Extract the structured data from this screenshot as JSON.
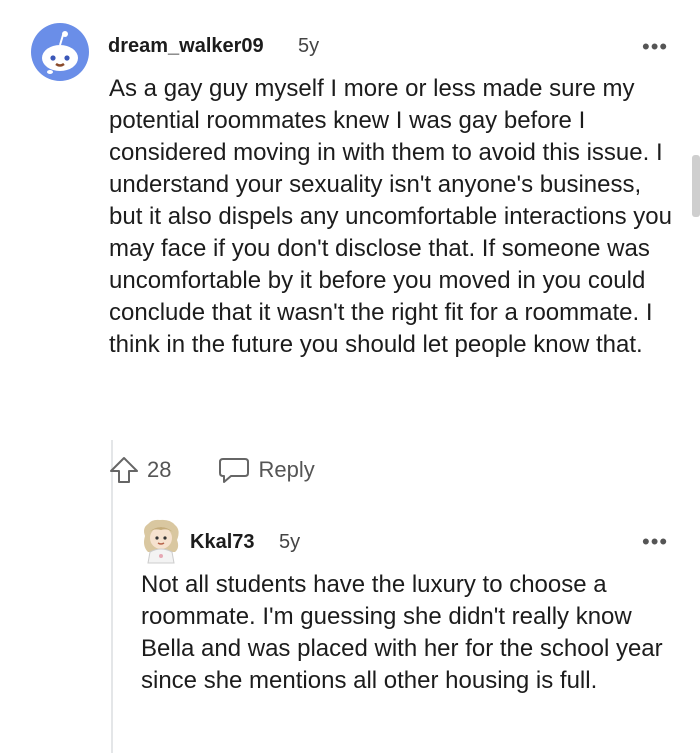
{
  "comment": {
    "username": "dream_walker09",
    "age": "5y",
    "more_label": "•••",
    "body": "As a gay guy myself I more or less made sure my potential roommates knew I was gay before I considered moving in with them to avoid this issue. I understand your sexuality isn't anyone's business, but it also dispels any uncomfortable interactions you may face if you don't disclose that. If someone was uncomfortable by it before you moved in you could conclude that it wasn't the right fit for a roommate. I think in the future you should let people know that.",
    "upvote_count": "28",
    "reply_label": "Reply",
    "avatar_icon": "snoo-avatar-icon",
    "accent_color": "#6a8ee8"
  },
  "reply": {
    "username": "Kkal73",
    "age": "5y",
    "more_label": "•••",
    "body": "Not all students have the luxury to choose a roommate. I'm guessing she didn't really know Bella and was placed with her for the school year since she mentions all other housing is full.",
    "avatar_icon": "cartoon-avatar-icon"
  },
  "icons": {
    "upvote": "upvote-arrow-icon",
    "reply": "speech-bubble-icon",
    "more": "more-options-icon"
  }
}
